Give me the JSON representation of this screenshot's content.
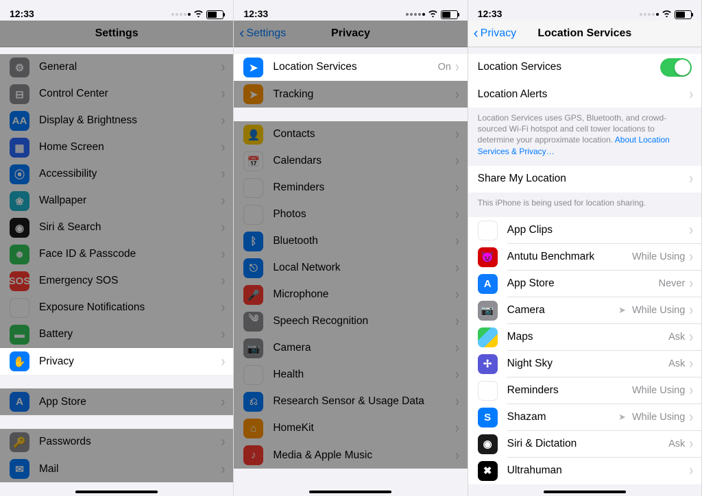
{
  "status": {
    "time": "12:33"
  },
  "panel1": {
    "title": "Settings",
    "groups": [
      {
        "items": [
          {
            "label": "General",
            "iconClass": "bg-grey",
            "glyph": "⚙"
          },
          {
            "label": "Control Center",
            "iconClass": "bg-grey",
            "glyph": "⊟"
          },
          {
            "label": "Display & Brightness",
            "iconClass": "bg-blue",
            "glyph": "AA"
          },
          {
            "label": "Home Screen",
            "iconClass": "bg-blue2",
            "glyph": "▦"
          },
          {
            "label": "Accessibility",
            "iconClass": "bg-blue",
            "glyph": "⦿"
          },
          {
            "label": "Wallpaper",
            "iconClass": "bg-teal",
            "glyph": "❀"
          },
          {
            "label": "Siri & Search",
            "iconClass": "bg-dark",
            "glyph": "◉"
          },
          {
            "label": "Face ID & Passcode",
            "iconClass": "bg-green",
            "glyph": "☻"
          },
          {
            "label": "Emergency SOS",
            "iconClass": "bg-red",
            "glyph": "SOS"
          },
          {
            "label": "Exposure Notifications",
            "iconClass": "bg-white",
            "glyph": "✹"
          },
          {
            "label": "Battery",
            "iconClass": "bg-green",
            "glyph": "▬"
          },
          {
            "label": "Privacy",
            "iconClass": "bg-blue",
            "glyph": "✋",
            "highlight": true
          }
        ]
      },
      {
        "items": [
          {
            "label": "App Store",
            "iconClass": "bg-appblue",
            "glyph": "A"
          }
        ]
      },
      {
        "items": [
          {
            "label": "Passwords",
            "iconClass": "bg-grey",
            "glyph": "🔑"
          },
          {
            "label": "Mail",
            "iconClass": "bg-blue",
            "glyph": "✉"
          }
        ]
      }
    ]
  },
  "panel2": {
    "back": "Settings",
    "title": "Privacy",
    "groups": [
      {
        "items": [
          {
            "label": "Location Services",
            "iconClass": "bg-blue",
            "glyph": "➤",
            "detail": "On",
            "highlight": true
          },
          {
            "label": "Tracking",
            "iconClass": "bg-orange",
            "glyph": "➤"
          }
        ]
      },
      {
        "items": [
          {
            "label": "Contacts",
            "iconClass": "bg-yellow",
            "glyph": "👤"
          },
          {
            "label": "Calendars",
            "iconClass": "bg-white",
            "glyph": "📅"
          },
          {
            "label": "Reminders",
            "iconClass": "bg-white",
            "glyph": "≣"
          },
          {
            "label": "Photos",
            "iconClass": "bg-white",
            "glyph": "❀"
          },
          {
            "label": "Bluetooth",
            "iconClass": "bg-blue",
            "glyph": "ᛒ"
          },
          {
            "label": "Local Network",
            "iconClass": "bg-blue",
            "glyph": "⎋"
          },
          {
            "label": "Microphone",
            "iconClass": "bg-red",
            "glyph": "🎤"
          },
          {
            "label": "Speech Recognition",
            "iconClass": "bg-grey",
            "glyph": "༄"
          },
          {
            "label": "Camera",
            "iconClass": "bg-grey",
            "glyph": "📷"
          },
          {
            "label": "Health",
            "iconClass": "bg-white",
            "glyph": "♥"
          },
          {
            "label": "Research Sensor & Usage Data",
            "iconClass": "bg-blue",
            "glyph": "⎌"
          },
          {
            "label": "HomeKit",
            "iconClass": "bg-orange",
            "glyph": "⌂"
          },
          {
            "label": "Media & Apple Music",
            "iconClass": "bg-red",
            "glyph": "♪"
          }
        ]
      }
    ]
  },
  "panel3": {
    "back": "Privacy",
    "title": "Location Services",
    "switchRow": {
      "label": "Location Services"
    },
    "alertsRow": {
      "label": "Location Alerts"
    },
    "footer1": "Location Services uses GPS, Bluetooth, and crowd-sourced Wi-Fi hotspot and cell tower locations to determine your approximate location. ",
    "footer1Link": "About Location Services & Privacy…",
    "shareRow": {
      "label": "Share My Location"
    },
    "footer2": "This iPhone is being used for location sharing.",
    "apps": [
      {
        "label": "App Clips",
        "iconClass": "bg-whiteB",
        "glyph": "◧",
        "detail": ""
      },
      {
        "label": "Antutu Benchmark",
        "iconClass": "bg-redA",
        "glyph": "😈",
        "detail": "While Using"
      },
      {
        "label": "App Store",
        "iconClass": "bg-appblue",
        "glyph": "A",
        "detail": "Never"
      },
      {
        "label": "Camera",
        "iconClass": "bg-grey",
        "glyph": "📷",
        "detail": "While Using",
        "nav": true
      },
      {
        "label": "Maps",
        "iconClass": "bg-mix",
        "glyph": "",
        "detail": "Ask"
      },
      {
        "label": "Night Sky",
        "iconClass": "bg-purple",
        "glyph": "✢",
        "detail": "Ask"
      },
      {
        "label": "Reminders",
        "iconClass": "bg-white",
        "glyph": "≣",
        "detail": "While Using"
      },
      {
        "label": "Shazam",
        "iconClass": "bg-blue",
        "glyph": "S",
        "detail": "While Using",
        "nav": true
      },
      {
        "label": "Siri & Dictation",
        "iconClass": "bg-dark",
        "glyph": "◉",
        "detail": "Ask"
      },
      {
        "label": "Ultrahuman",
        "iconClass": "bg-black",
        "glyph": "✖",
        "detail": ""
      }
    ]
  }
}
